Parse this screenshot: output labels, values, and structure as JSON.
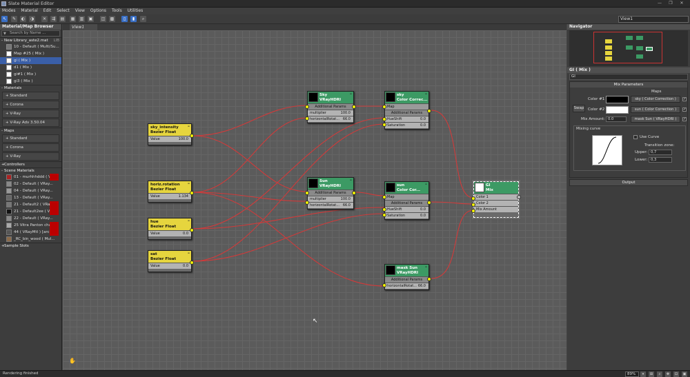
{
  "window": {
    "title": "Slate Material Editor",
    "min": "—",
    "max": "❐",
    "close": "✕"
  },
  "menu": [
    "Modes",
    "Material",
    "Edit",
    "Select",
    "View",
    "Options",
    "Tools",
    "Utilities"
  ],
  "toolbar": {
    "view_select": "View1"
  },
  "browser": {
    "title": "Material/Map Browser",
    "search_placeholder": "Search by Name ...",
    "library": {
      "title": "New Library_aste2.mat",
      "badge": "LIB",
      "items": [
        "10 - Default ( Multi/Su...",
        "Map #25 ( Mix )",
        "gi ( Mix )",
        "d1 ( Mix )",
        "gi#1 ( Mix )",
        "gi3 ( Mix )"
      ]
    },
    "materials": {
      "title": "Materials",
      "items": [
        "+ Standard",
        "+ Corona",
        "+ V-Ray",
        "+ V-Ray Adv 3.50.04"
      ]
    },
    "maps": {
      "title": "Maps",
      "items": [
        "+ Standard",
        "+ Corona",
        "+ V-Ray"
      ]
    },
    "controllers": "Controllers",
    "scene": {
      "title": "Scene Materials",
      "items": [
        "01 - murhhhddd ( V...",
        "02 - Default ( VRay...",
        "04 - Default ( VRay...",
        "13 - Default ( VRay...",
        "21 - Default2 ( VRay",
        "21 - Default2ee ( VR",
        "22 - Default ( VRay...",
        "25 Vitra Panton chair",
        "44 ( VRayMtl ) [arc...",
        "_RC_bin_wood ( Mul..."
      ]
    },
    "sample_slots": "Sample Slots"
  },
  "view": {
    "tab": "View1"
  },
  "nodes": {
    "sky_intensity": {
      "title": "sky_intensity",
      "type": "Bezier Float",
      "row_label": "Value",
      "row_value": "100.0"
    },
    "horiz_rotation": {
      "title": "horiz.rotation",
      "type": "Bezier Float",
      "row_label": "Value",
      "row_value": "1.134"
    },
    "hue": {
      "title": "hue",
      "type": "Bezier Float",
      "row_label": "Value",
      "row_value": "0.0"
    },
    "sat": {
      "title": "sat",
      "type": "Bezier Float",
      "row_label": "Value",
      "row_value": "0.0"
    },
    "sky_hdri": {
      "title": "Sky",
      "type": "VRayHDRI",
      "hdr": "Additional Params",
      "rows": [
        [
          "multiplier",
          "100.0"
        ],
        [
          "horizontalRotat...",
          "66.0"
        ]
      ]
    },
    "sun_hdri": {
      "title": "Sun",
      "type": "VRayHDRI",
      "hdr": "Additional Params",
      "rows": [
        [
          "multiplier",
          "100.0"
        ],
        [
          "horizontalRotat...",
          "66.0"
        ]
      ]
    },
    "sky_cc": {
      "title": "sky",
      "type": "Color Correc...",
      "map": "Map",
      "hdr": "Additional Params",
      "rows": [
        [
          "HueShift",
          "0.0"
        ],
        [
          "Saturation",
          "0.0"
        ]
      ]
    },
    "sun_cc": {
      "title": "sun",
      "type": "Color Cor...",
      "map": "Map",
      "hdr": "Additional Params",
      "rows": [
        [
          "HueShift",
          "0.0"
        ],
        [
          "Saturation",
          "0.0"
        ]
      ]
    },
    "mask_sun": {
      "title": "mask Sun",
      "type": "VRayHDRI",
      "hdr": "Additional Params",
      "rows": [
        [
          "horizontalRotat...",
          "66.0"
        ]
      ]
    },
    "gi_mix": {
      "title": "GI",
      "type": "Mix",
      "rows": [
        "Color 1",
        "Color 2",
        "Mix Amount"
      ]
    }
  },
  "navigator": {
    "title": "Navigator"
  },
  "params": {
    "title": "GI ( Mix )",
    "name_value": "GI",
    "rollout": "Mix Parameters",
    "maps_label": "Maps",
    "swap": "Swap",
    "color1_label": "Color #1",
    "color1_map": "sky ( Color Correction )",
    "color1_swatch": "#000000",
    "color2_label": "Color #2",
    "color2_map": "sun ( Color Correction )",
    "color2_swatch": "#ffffff",
    "mix_amount_label": "Mix Amount:",
    "mix_amount_value": "0.0",
    "mix_map": "mask Sun ( VRayHDRI )",
    "mixing_curve": "Mixing curve",
    "use_curve": "Use Curve",
    "transition": "Transition zone:",
    "upper_label": "Upper:",
    "upper_value": "0,7",
    "lower_label": "Lower:",
    "lower_value": "0,3",
    "output": "Output"
  },
  "status": {
    "text": "Rendering finished",
    "zoom": "89%"
  },
  "colors": {
    "wire": "#d23a3a",
    "socket": "#f2f200",
    "float_node": "#e6d53e",
    "map_node": "#3c9a64"
  }
}
